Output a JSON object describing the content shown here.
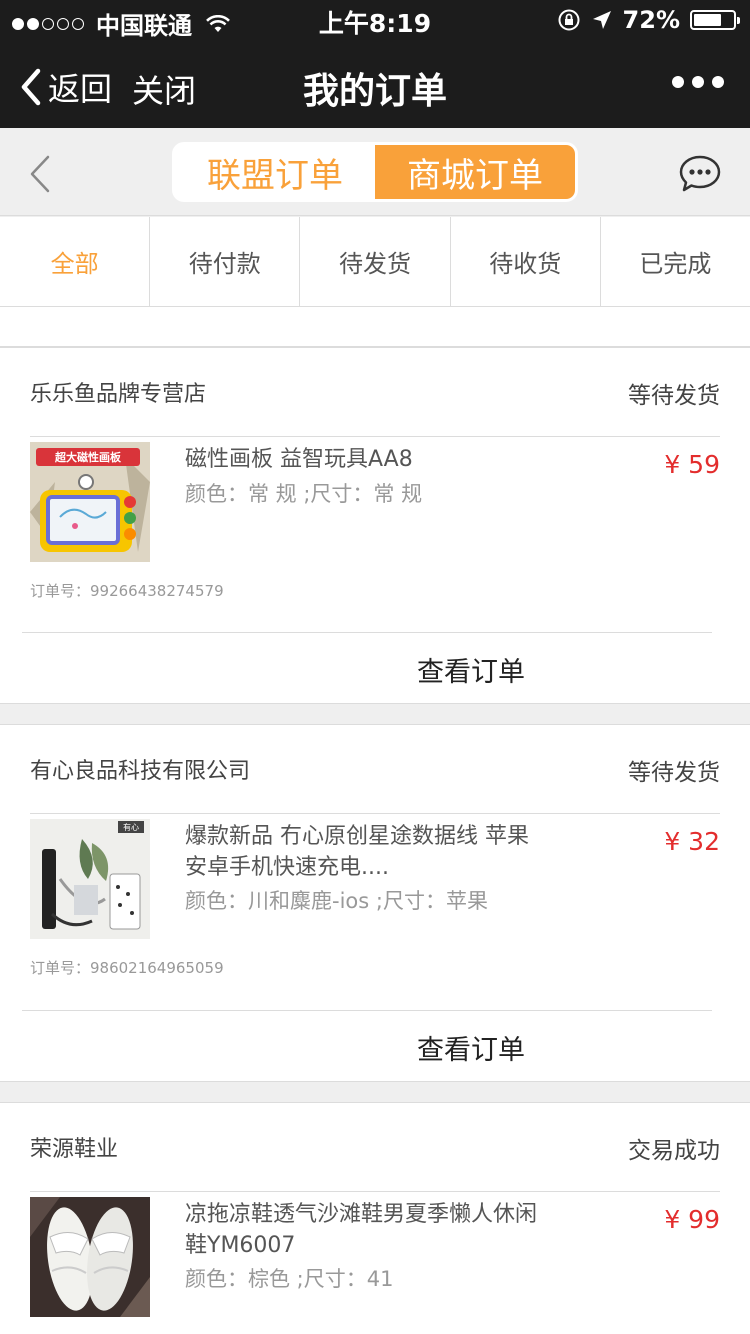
{
  "status_bar": {
    "carrier": "中国联通",
    "time": "上午8:19",
    "battery_pct": "72%",
    "battery_level": 0.72
  },
  "nav": {
    "back_label": "返回",
    "close_label": "关闭",
    "title": "我的订单"
  },
  "segmented": {
    "options": [
      "联盟订单",
      "商城订单"
    ],
    "selected": "商城订单"
  },
  "tabs": [
    "全部",
    "待付款",
    "待发货",
    "待收货",
    "已完成"
  ],
  "active_tab": "全部",
  "orders": [
    {
      "shop": "乐乐鱼品牌专营店",
      "status": "等待发货",
      "product_name": "磁性画板 益智玩具AA8",
      "attrs": "颜色：常 规 ;尺寸：常 规",
      "price": "¥ 59",
      "order_no": "订单号：99266438274579",
      "action": "查看订单",
      "thumb_label": "超大磁性画板"
    },
    {
      "shop": "有心良品科技有限公司",
      "status": "等待发货",
      "product_name": "爆款新品 冇心原创星途数据线 苹果安卓手机快速充电....",
      "attrs": "颜色：川和麋鹿-ios ;尺寸：苹果",
      "price": "¥ 32",
      "order_no": "订单号：98602164965059",
      "action": "查看订单",
      "thumb_label": "有心"
    },
    {
      "shop": "荣源鞋业",
      "status": "交易成功",
      "product_name": "凉拖凉鞋透气沙滩鞋男夏季懒人休闲鞋YM6007",
      "attrs": "颜色：棕色 ;尺寸：41",
      "price": "¥ 99"
    }
  ],
  "colors": {
    "accent": "#f9a13a",
    "price": "#e32d2d",
    "bar": "#1c1c1c"
  }
}
